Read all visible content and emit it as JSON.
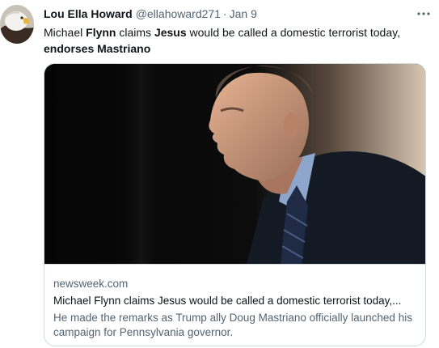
{
  "tweet": {
    "author_name": "Lou Ella Howard",
    "handle": "@ellahoward271",
    "separator": "·",
    "date": "Jan 9",
    "more_icon": "more-horizontal-icon",
    "text_segments": [
      {
        "text": "Michael ",
        "bold": false
      },
      {
        "text": "Flynn",
        "bold": true
      },
      {
        "text": " claims ",
        "bold": false
      },
      {
        "text": "Jesus",
        "bold": true
      },
      {
        "text": " would be called a domestic terrorist today, ",
        "bold": false
      },
      {
        "text": "endorses Mastriano",
        "bold": true
      }
    ]
  },
  "card": {
    "domain": "newsweek.com",
    "title": "Michael Flynn claims Jesus would be called a domestic terrorist today,...",
    "description": "He made the remarks as Trump ally Doug Mastriano officially launched his campaign for Pennsylvania governor."
  },
  "colors": {
    "text_primary": "#0f1419",
    "text_secondary": "#536471",
    "border": "#cfd9de"
  }
}
